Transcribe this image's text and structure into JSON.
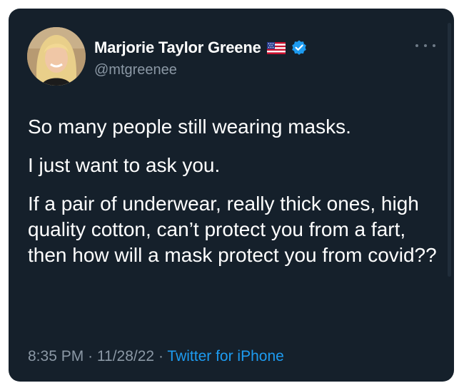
{
  "tweet": {
    "author": {
      "display_name": "Marjorie Taylor Greene",
      "handle": "@mtgreenee",
      "flag_icon": "us-flag-icon",
      "verified_icon": "verified-badge-icon",
      "avatar": "avatar"
    },
    "more_icon": "more-horizontal-icon",
    "paragraphs": [
      "So many people still wearing masks.",
      "I just want to ask you.",
      "If a pair of underwear, really thick ones, high quality cotton, can’t protect you from a fart, then how will a mask protect you from covid??"
    ],
    "time": "8:35 PM",
    "separator": "·",
    "date": "11/28/22",
    "source": "Twitter for iPhone"
  },
  "colors": {
    "card_background": "#15202b",
    "text_primary": "#ffffff",
    "text_secondary": "#8b98a5",
    "link": "#1d9bf0",
    "verified": "#1d9bf0"
  }
}
